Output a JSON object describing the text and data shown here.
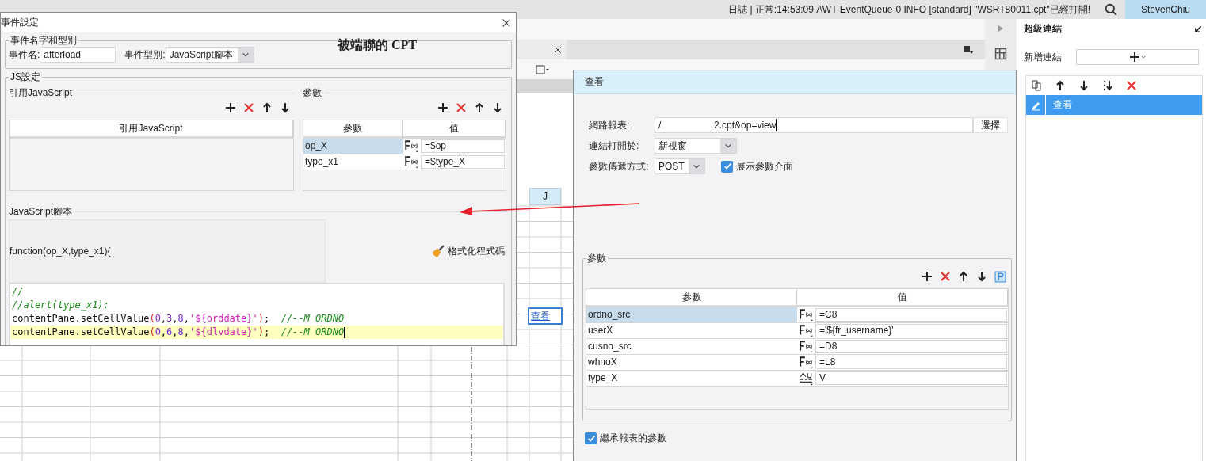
{
  "status_bar": {
    "log": "日誌 | 正常:14:53:09 AWT-EventQueue-0 INFO [standard] \"WSRT80011.cpt\"已經打開!",
    "user": "StevenChiu"
  },
  "sheet": {
    "column_header": "J",
    "cell_link": "查看"
  },
  "side_panel": {
    "title": "超級連結",
    "add_label": "新增連結",
    "links": [
      {
        "label": "查看",
        "selected": true
      }
    ]
  },
  "event_dialog": {
    "title": "事件設定",
    "name_group": "事件名字和型別",
    "name_label": "事件名:",
    "name_value": "afterload",
    "type_label": "事件型別:",
    "type_value": "JavaScript腳本",
    "annotation": "被端聯的 CPT",
    "js_group": "JS設定",
    "ref_section": "引用JavaScript",
    "ref_column": "引用JavaScript",
    "params_section": "參數",
    "param_columns": [
      "參數",
      "值"
    ],
    "params": [
      {
        "name": "op_X",
        "kind": "formula",
        "value": "=$op",
        "selected": true
      },
      {
        "name": "type_x1",
        "kind": "formula",
        "value": "=$type_X",
        "selected": false
      }
    ],
    "script_section": "JavaScript腳本",
    "signature": "function(op_X,type_x1){",
    "format_button": "格式化程式碼",
    "code_lines": [
      {
        "highlighted": false,
        "tokens": [
          {
            "kind": "comment",
            "text": "//"
          }
        ]
      },
      {
        "highlighted": false,
        "tokens": [
          {
            "kind": "comment",
            "text": "//alert(type_x1);"
          }
        ]
      },
      {
        "highlighted": false,
        "tokens": [
          {
            "kind": "plain",
            "text": "contentPane.setCellValue"
          },
          {
            "kind": "paren",
            "text": "("
          },
          {
            "kind": "number",
            "text": "0"
          },
          {
            "kind": "plain",
            "text": ","
          },
          {
            "kind": "number",
            "text": "3"
          },
          {
            "kind": "plain",
            "text": ","
          },
          {
            "kind": "number",
            "text": "8"
          },
          {
            "kind": "plain",
            "text": ","
          },
          {
            "kind": "string",
            "text": "'${orddate}'"
          },
          {
            "kind": "paren",
            "text": ")"
          },
          {
            "kind": "plain",
            "text": ";  "
          },
          {
            "kind": "comment",
            "text": "//--M ORDNO"
          }
        ]
      },
      {
        "highlighted": true,
        "tokens": [
          {
            "kind": "plain",
            "text": "contentPane.setCellValue"
          },
          {
            "kind": "paren",
            "text": "("
          },
          {
            "kind": "number",
            "text": "0"
          },
          {
            "kind": "plain",
            "text": ","
          },
          {
            "kind": "number",
            "text": "6"
          },
          {
            "kind": "plain",
            "text": ","
          },
          {
            "kind": "number",
            "text": "8"
          },
          {
            "kind": "plain",
            "text": ","
          },
          {
            "kind": "string",
            "text": "'${dlvdate}'"
          },
          {
            "kind": "paren",
            "text": ")"
          },
          {
            "kind": "plain",
            "text": ";  "
          },
          {
            "kind": "comment",
            "text": "//--M ORDNO"
          }
        ]
      }
    ]
  },
  "view_dialog": {
    "title": "查看",
    "report_label": "網路報表:",
    "report_value": "/                    2.cpt&op=view",
    "choose_button": "選擇",
    "open_label": "連結打開於:",
    "open_value": "新視窗",
    "method_label": "參數傳遞方式:",
    "method_value": "POST",
    "show_params": {
      "label": "展示參數介面",
      "checked": true
    },
    "params_section": "參數",
    "param_columns": [
      "參數",
      "值"
    ],
    "params": [
      {
        "name": "ordno_src",
        "kind": "formula",
        "value": "=C8",
        "selected": true
      },
      {
        "name": "userX",
        "kind": "formula",
        "value": "='${fr_username}'",
        "selected": false
      },
      {
        "name": "cusno_src",
        "kind": "formula",
        "value": "=D8",
        "selected": false
      },
      {
        "name": "whnoX",
        "kind": "formula",
        "value": "=L8",
        "selected": false
      },
      {
        "name": "type_X",
        "kind": "text",
        "value": "V",
        "selected": false
      }
    ],
    "inherit": {
      "label": "繼承報表的參數",
      "checked": true
    }
  }
}
